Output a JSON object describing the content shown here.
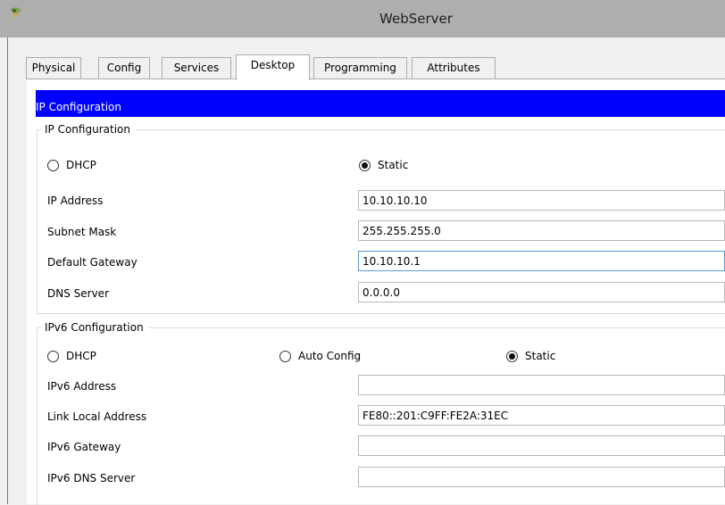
{
  "window": {
    "title": "WebServer",
    "icon": "packet-tracer-device-icon"
  },
  "tabs": [
    {
      "label": "Physical",
      "active": false
    },
    {
      "label": "Config",
      "active": false
    },
    {
      "label": "Services",
      "active": false
    },
    {
      "label": "Desktop",
      "active": true
    },
    {
      "label": "Programming",
      "active": false
    },
    {
      "label": "Attributes",
      "active": false
    }
  ],
  "header": {
    "title": "IP Configuration",
    "color": "#0000ff"
  },
  "ipv4": {
    "legend": "IP Configuration",
    "mode_options": [
      {
        "label": "DHCP",
        "selected": false
      },
      {
        "label": "Static",
        "selected": true
      }
    ],
    "fields": {
      "ip_address": {
        "label": "IP Address",
        "value": "10.10.10.10"
      },
      "subnet_mask": {
        "label": "Subnet Mask",
        "value": "255.255.255.0"
      },
      "default_gateway": {
        "label": "Default Gateway",
        "value": "10.10.10.1"
      },
      "dns_server": {
        "label": "DNS Server",
        "value": "0.0.0.0"
      }
    }
  },
  "ipv6": {
    "legend": "IPv6 Configuration",
    "mode_options": [
      {
        "label": "DHCP",
        "selected": false
      },
      {
        "label": "Auto Config",
        "selected": false
      },
      {
        "label": "Static",
        "selected": true
      }
    ],
    "fields": {
      "ipv6_address": {
        "label": "IPv6 Address",
        "value": ""
      },
      "link_local_address": {
        "label": "Link Local Address",
        "value": "FE80::201:C9FF:FE2A:31EC"
      },
      "ipv6_gateway": {
        "label": "IPv6 Gateway",
        "value": ""
      },
      "ipv6_dns_server": {
        "label": "IPv6 DNS Server",
        "value": ""
      }
    }
  }
}
